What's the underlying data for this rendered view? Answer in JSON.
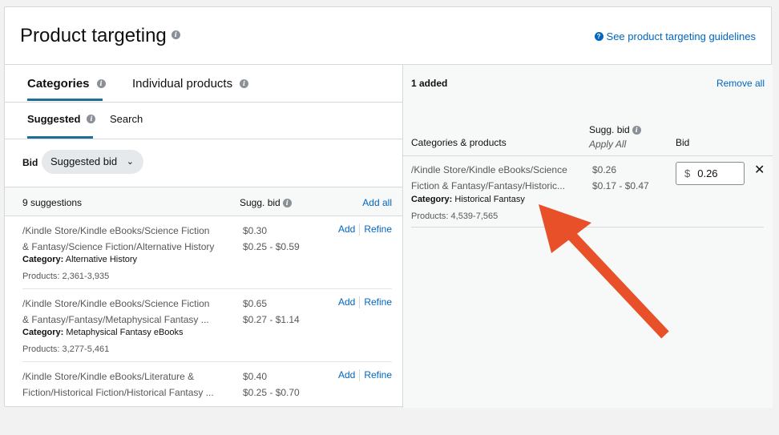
{
  "header": {
    "title": "Product targeting",
    "guidelines_link": "See product targeting guidelines"
  },
  "tabs": [
    {
      "label": "Categories",
      "active": true
    },
    {
      "label": "Individual products",
      "active": false
    }
  ],
  "subtabs": [
    {
      "label": "Suggested",
      "active": true
    },
    {
      "label": "Search",
      "active": false
    }
  ],
  "bid": {
    "label": "Bid",
    "selected": "Suggested bid"
  },
  "list": {
    "count_label": "9 suggestions",
    "sugg_bid_header": "Sugg. bid",
    "add_all": "Add all",
    "add_label": "Add",
    "refine_label": "Refine",
    "category_prefix": "Category:",
    "items": [
      {
        "path_line1": "/Kindle Store/Kindle eBooks/Science Fiction",
        "path_line2": "& Fantasy/Science Fiction/Alternative History",
        "category": "Alternative History",
        "products": "Products: 2,361-3,935",
        "bid": "$0.30",
        "range": "$0.25 - $0.59"
      },
      {
        "path_line1": "/Kindle Store/Kindle eBooks/Science Fiction",
        "path_line2": "& Fantasy/Fantasy/Metaphysical Fantasy ...",
        "category": "Metaphysical Fantasy eBooks",
        "products": "Products: 3,277-5,461",
        "bid": "$0.65",
        "range": "$0.27 - $1.14"
      },
      {
        "path_line1": "/Kindle Store/Kindle eBooks/Literature &",
        "path_line2": "Fiction/Historical Fiction/Historical Fantasy ...",
        "category": "",
        "products": "",
        "bid": "$0.40",
        "range": "$0.25 - $0.70"
      }
    ]
  },
  "added": {
    "count_label": "1 added",
    "remove_all": "Remove all",
    "col_categories": "Categories & products",
    "col_sugg_bid": "Sugg. bid",
    "col_apply_all": "Apply All",
    "col_bid": "Bid",
    "item": {
      "path_line1": "/Kindle Store/Kindle eBooks/Science",
      "path_line2": "Fiction & Fantasy/Fantasy/Historic...",
      "category_prefix": "Category:",
      "category": "Historical Fantasy",
      "products": "Products: 4,539-7,565",
      "bid": "$0.26",
      "range": "$0.17 - $0.47",
      "currency": "$",
      "bid_value": "0.26"
    }
  },
  "colors": {
    "link": "#0066c0",
    "tab_underline": "#1e6e98",
    "annotation_arrow": "#e8502a"
  }
}
